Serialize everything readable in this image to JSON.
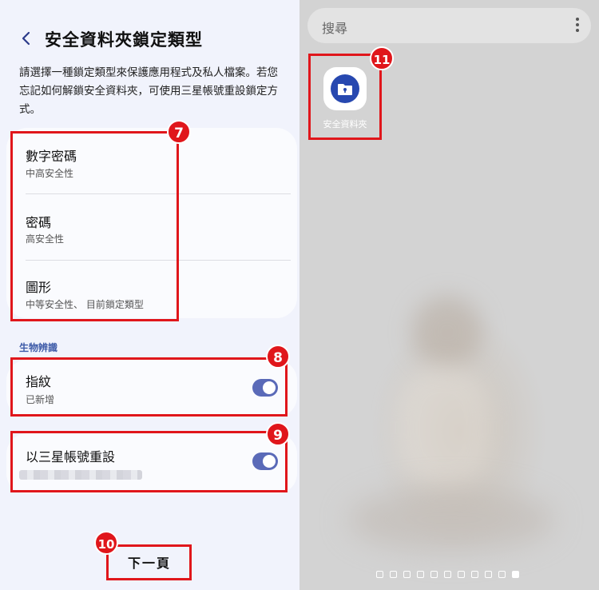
{
  "header": {
    "title": "安全資料夾鎖定類型"
  },
  "description": "請選擇一種鎖定類型來保護應用程式及私人檔案。若您忘記如何解鎖安全資料夾，可使用三星帳號重設鎖定方式。",
  "lock_types": [
    {
      "title": "數字密碼",
      "subtitle": "中高安全性"
    },
    {
      "title": "密碼",
      "subtitle": "高安全性"
    },
    {
      "title": "圖形",
      "subtitle": "中等安全性、 目前鎖定類型"
    }
  ],
  "biometrics": {
    "section_label": "生物辨識",
    "fingerprint": {
      "title": "指紋",
      "subtitle": "已新增",
      "enabled": true
    }
  },
  "samsung_reset": {
    "title": "以三星帳號重設",
    "enabled": true
  },
  "footer": {
    "next_label": "下一頁"
  },
  "annotations": {
    "b7": "7",
    "b8": "8",
    "b9": "9",
    "b10": "10",
    "b11": "11"
  },
  "launcher": {
    "search_placeholder": "搜尋",
    "app_label": "安全資料夾",
    "page_count": 11,
    "active_page": 11
  },
  "colors": {
    "annotation": "#e0161b",
    "toggle": "#5a6ab8",
    "app_icon": "#2748b0"
  }
}
